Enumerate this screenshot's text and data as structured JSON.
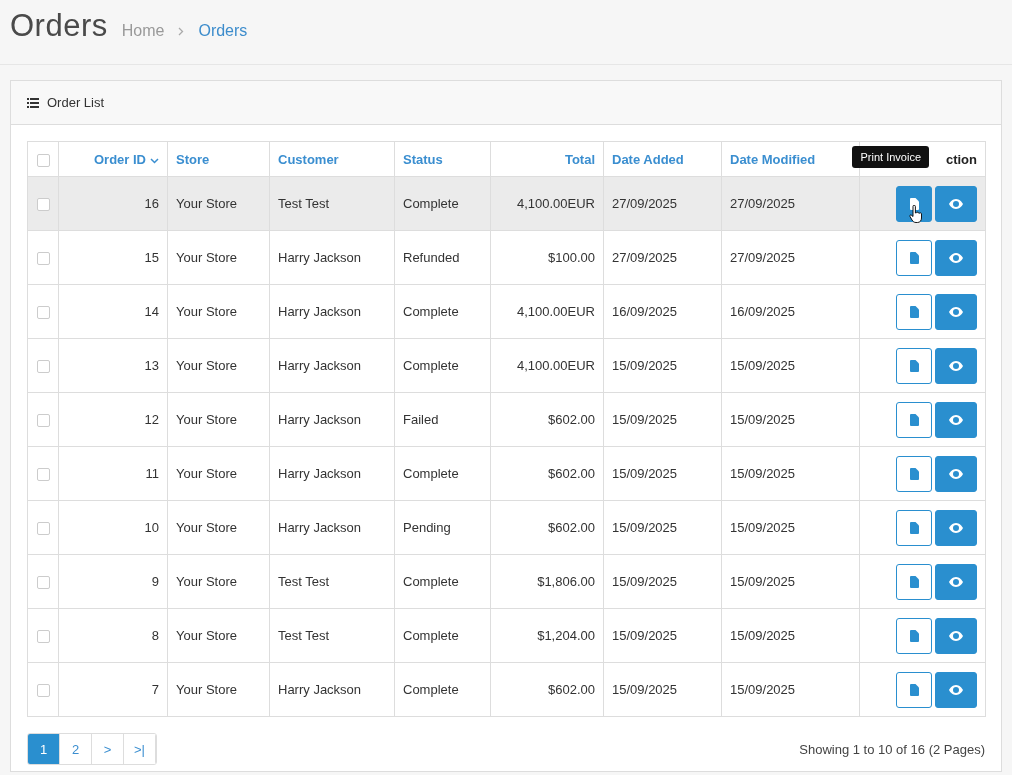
{
  "page": {
    "title": "Orders",
    "breadcrumb": [
      {
        "label": "Home",
        "current": false
      },
      {
        "label": "Orders",
        "current": true
      }
    ]
  },
  "panel": {
    "title": "Order List"
  },
  "table": {
    "columns": [
      {
        "label": "Order ID",
        "kind": "number",
        "sorted": true
      },
      {
        "label": "Store",
        "kind": "text",
        "sorted": false
      },
      {
        "label": "Customer",
        "kind": "text",
        "sorted": false
      },
      {
        "label": "Status",
        "kind": "text",
        "sorted": false
      },
      {
        "label": "Total",
        "kind": "number",
        "sorted": false
      },
      {
        "label": "Date Added",
        "kind": "text",
        "sorted": false
      },
      {
        "label": "Date Modified",
        "kind": "text",
        "sorted": false
      },
      {
        "label": "ction",
        "kind": "action",
        "sorted": false
      }
    ],
    "rows": [
      {
        "cells": [
          "16",
          "Your Store",
          "Test Test",
          "Complete",
          "4,100.00EUR",
          "27/09/2025",
          "27/09/2025"
        ],
        "checked": false,
        "highlighted": true
      },
      {
        "cells": [
          "15",
          "Your Store",
          "Harry Jackson",
          "Refunded",
          "$100.00",
          "27/09/2025",
          "27/09/2025"
        ],
        "checked": false,
        "highlighted": false
      },
      {
        "cells": [
          "14",
          "Your Store",
          "Harry Jackson",
          "Complete",
          "4,100.00EUR",
          "16/09/2025",
          "16/09/2025"
        ],
        "checked": false,
        "highlighted": false
      },
      {
        "cells": [
          "13",
          "Your Store",
          "Harry Jackson",
          "Complete",
          "4,100.00EUR",
          "15/09/2025",
          "15/09/2025"
        ],
        "checked": false,
        "highlighted": false
      },
      {
        "cells": [
          "12",
          "Your Store",
          "Harry Jackson",
          "Failed",
          "$602.00",
          "15/09/2025",
          "15/09/2025"
        ],
        "checked": false,
        "highlighted": false
      },
      {
        "cells": [
          "11",
          "Your Store",
          "Harry Jackson",
          "Complete",
          "$602.00",
          "15/09/2025",
          "15/09/2025"
        ],
        "checked": false,
        "highlighted": false
      },
      {
        "cells": [
          "10",
          "Your Store",
          "Harry Jackson",
          "Pending",
          "$602.00",
          "15/09/2025",
          "15/09/2025"
        ],
        "checked": false,
        "highlighted": false
      },
      {
        "cells": [
          "9",
          "Your Store",
          "Test Test",
          "Complete",
          "$1,806.00",
          "15/09/2025",
          "15/09/2025"
        ],
        "checked": false,
        "highlighted": false
      },
      {
        "cells": [
          "8",
          "Your Store",
          "Test Test",
          "Complete",
          "$1,204.00",
          "15/09/2025",
          "15/09/2025"
        ],
        "checked": false,
        "highlighted": false
      },
      {
        "cells": [
          "7",
          "Your Store",
          "Harry Jackson",
          "Complete",
          "$602.00",
          "15/09/2025",
          "15/09/2025"
        ],
        "checked": false,
        "highlighted": false
      }
    ],
    "header_checked": false
  },
  "tooltip": {
    "text": "Print Invoice"
  },
  "pagination": {
    "pages": [
      {
        "label": "1",
        "selected": true
      },
      {
        "label": "2",
        "selected": false
      },
      {
        "label": ">",
        "selected": false
      },
      {
        "label": ">|",
        "selected": false
      }
    ],
    "summary": "Showing 1 to 10 of 16 (2 Pages)"
  }
}
